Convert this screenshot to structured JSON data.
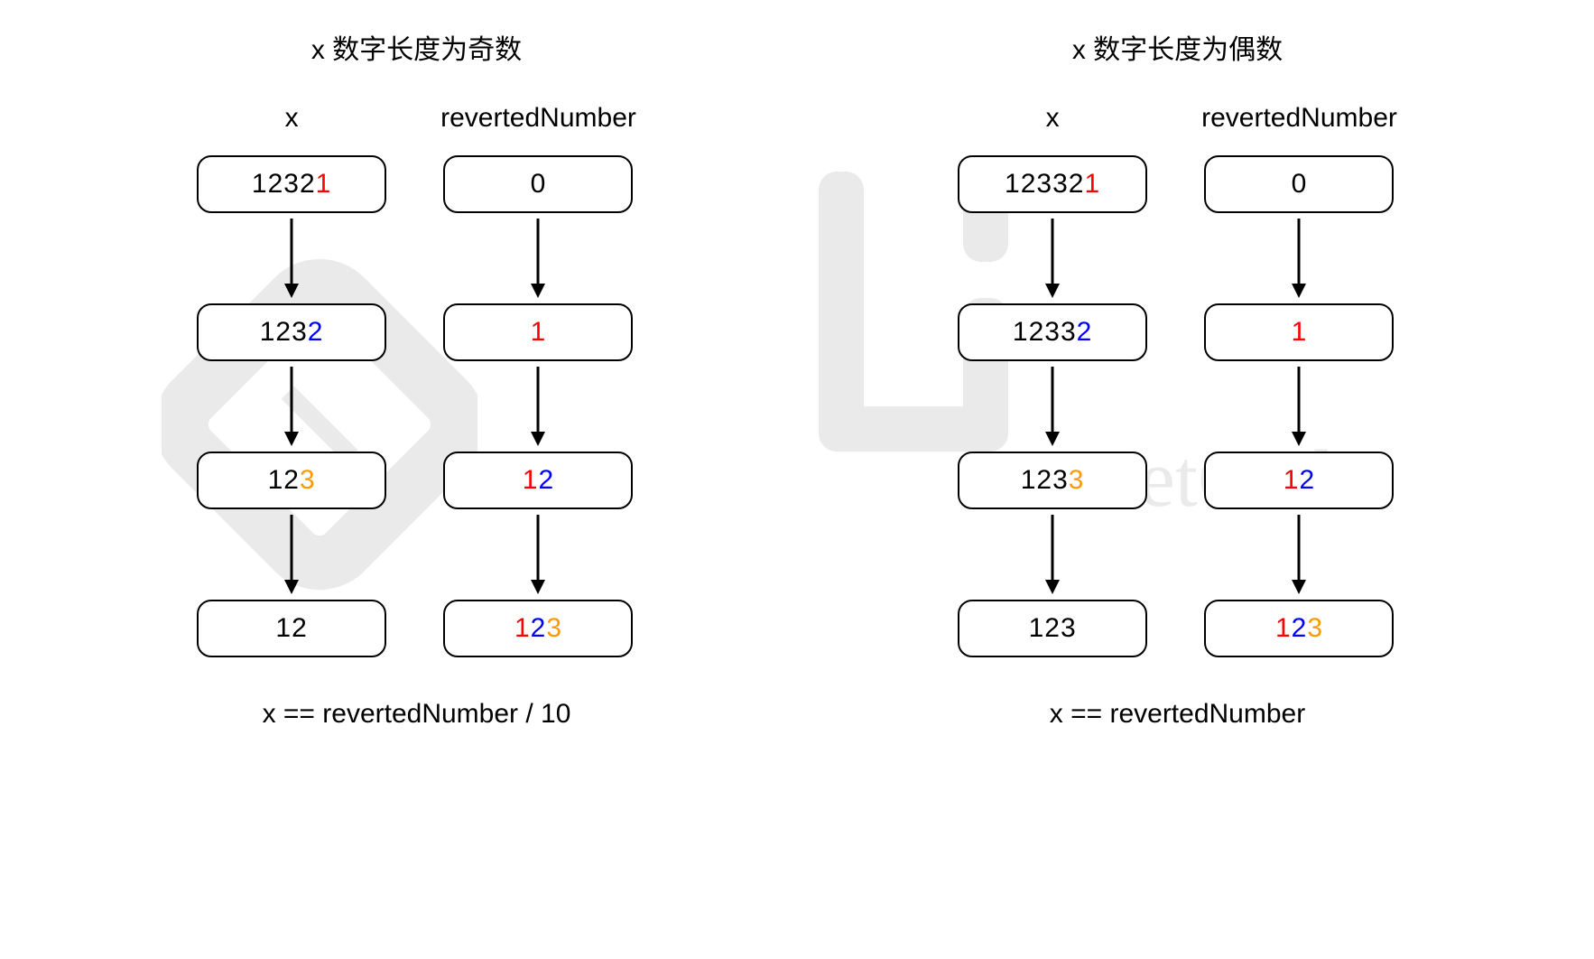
{
  "sections": [
    {
      "title": "x 数字长度为奇数",
      "colA_title": "x",
      "colB_title": "revertedNumber",
      "footer": "x == revertedNumber / 10",
      "rows": [
        {
          "x": [
            {
              "t": "1232",
              "c": ""
            },
            {
              "t": "1",
              "c": "red"
            }
          ],
          "r": [
            {
              "t": "0",
              "c": ""
            }
          ]
        },
        {
          "x": [
            {
              "t": "123",
              "c": ""
            },
            {
              "t": "2",
              "c": "blue"
            }
          ],
          "r": [
            {
              "t": "1",
              "c": "red"
            }
          ]
        },
        {
          "x": [
            {
              "t": "12",
              "c": ""
            },
            {
              "t": "3",
              "c": "orange"
            }
          ],
          "r": [
            {
              "t": "1",
              "c": "red"
            },
            {
              "t": "2",
              "c": "blue"
            }
          ]
        },
        {
          "x": [
            {
              "t": "12",
              "c": ""
            }
          ],
          "r": [
            {
              "t": "1",
              "c": "red"
            },
            {
              "t": "2",
              "c": "blue"
            },
            {
              "t": "3",
              "c": "orange"
            }
          ]
        }
      ]
    },
    {
      "title": "x 数字长度为偶数",
      "colA_title": "x",
      "colB_title": "revertedNumber",
      "footer": "x == revertedNumber",
      "rows": [
        {
          "x": [
            {
              "t": "12332",
              "c": ""
            },
            {
              "t": "1",
              "c": "red"
            }
          ],
          "r": [
            {
              "t": "0",
              "c": ""
            }
          ]
        },
        {
          "x": [
            {
              "t": "1233",
              "c": ""
            },
            {
              "t": "2",
              "c": "blue"
            }
          ],
          "r": [
            {
              "t": "1",
              "c": "red"
            }
          ]
        },
        {
          "x": [
            {
              "t": "123",
              "c": ""
            },
            {
              "t": "3",
              "c": "orange"
            }
          ],
          "r": [
            {
              "t": "1",
              "c": "red"
            },
            {
              "t": "2",
              "c": "blue"
            }
          ]
        },
        {
          "x": [
            {
              "t": "123",
              "c": ""
            }
          ],
          "r": [
            {
              "t": "1",
              "c": "red"
            },
            {
              "t": "2",
              "c": "blue"
            },
            {
              "t": "3",
              "c": "orange"
            }
          ]
        }
      ]
    }
  ]
}
